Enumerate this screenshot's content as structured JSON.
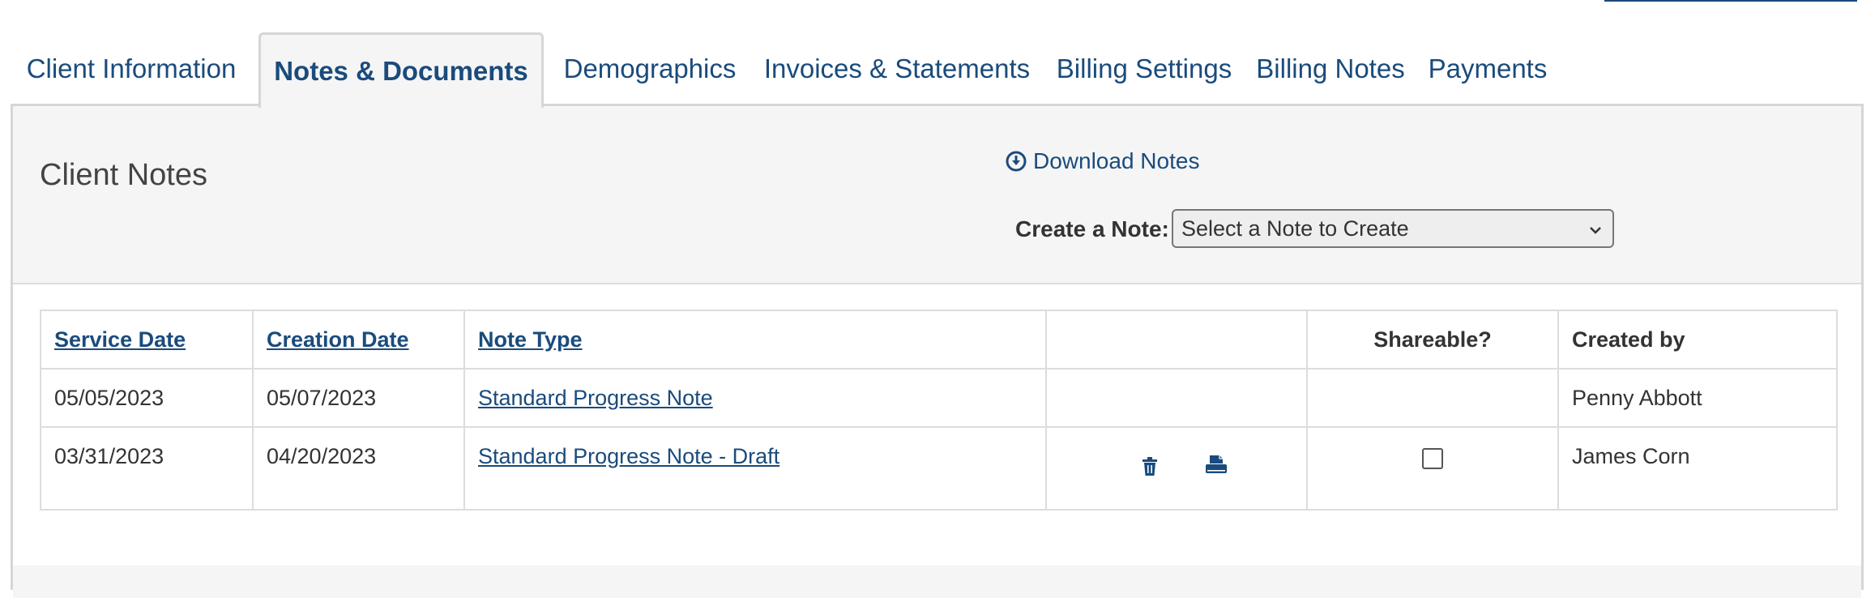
{
  "tabs": [
    {
      "label": "Client Information"
    },
    {
      "label": "Notes & Documents"
    },
    {
      "label": "Demographics"
    },
    {
      "label": "Invoices & Statements"
    },
    {
      "label": "Billing Settings"
    },
    {
      "label": "Billing Notes"
    },
    {
      "label": "Payments"
    }
  ],
  "active_tab": "Notes & Documents",
  "panel": {
    "title": "Client Notes",
    "download_label": "Download Notes",
    "create_label": "Create a Note:",
    "select_value": "Select a Note to Create"
  },
  "table": {
    "headers": {
      "service_date": "Service Date",
      "creation_date": "Creation Date",
      "note_type": "Note Type",
      "actions": "",
      "shareable": "Shareable?",
      "created_by": "Created by"
    },
    "rows": [
      {
        "service_date": "05/05/2023",
        "creation_date": "05/07/2023",
        "note_type": "Standard Progress Note",
        "created_by": "Penny Abbott"
      },
      {
        "service_date": "03/31/2023",
        "creation_date": "04/20/2023",
        "note_type": "Standard Progress Note - Draft",
        "created_by": "James Corn",
        "shareable_checked": false
      }
    ]
  },
  "icons": {
    "download": "download-circle-icon",
    "select": "chevron-down-icon",
    "delete": "trash-icon",
    "print": "print-icon"
  },
  "colors": {
    "link": "#1a4b7c",
    "panel_bg": "#f5f5f5",
    "border": "#d6d6d6"
  }
}
